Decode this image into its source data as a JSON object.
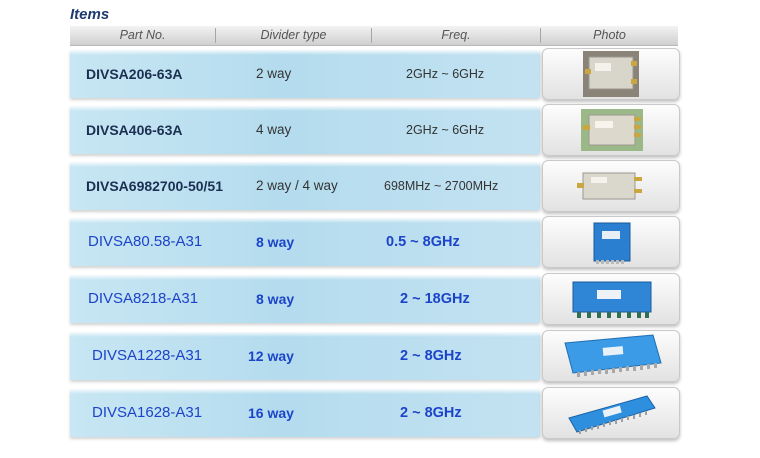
{
  "section_title": "Items",
  "headers": {
    "part": "Part No.",
    "type": "Divider type",
    "freq": "Freq.",
    "photo": "Photo"
  },
  "rows": [
    {
      "part": "DIVSA206-63A",
      "type": "2 way",
      "freq": "2GHz ~ 6GHz"
    },
    {
      "part": "DIVSA406-63A",
      "type": "4 way",
      "freq": "2GHz ~ 6GHz"
    },
    {
      "part": "DIVSA6982700-50/51",
      "type": "2 way / 4 way",
      "freq": "698MHz ~ 2700MHz"
    },
    {
      "part": "DIVSA80.58-A31",
      "type": "8 way",
      "freq": "0.5 ~ 8GHz"
    },
    {
      "part": "DIVSA8218-A31",
      "type": "8 way",
      "freq": "2 ~ 18GHz"
    },
    {
      "part": "DIVSA1228-A31",
      "type": "12 way",
      "freq": "2 ~ 8GHz"
    },
    {
      "part": "DIVSA1628-A31",
      "type": "16 way",
      "freq": "2 ~ 8GHz"
    }
  ],
  "colors": {
    "title": "#1e3a6e",
    "row_text_dark": "#1b2f52",
    "row_text_blue": "#1c44c9",
    "row_bg": "#b4dcee",
    "product_grey": "#d6d3c8",
    "product_blue": "#2a7fd0"
  }
}
